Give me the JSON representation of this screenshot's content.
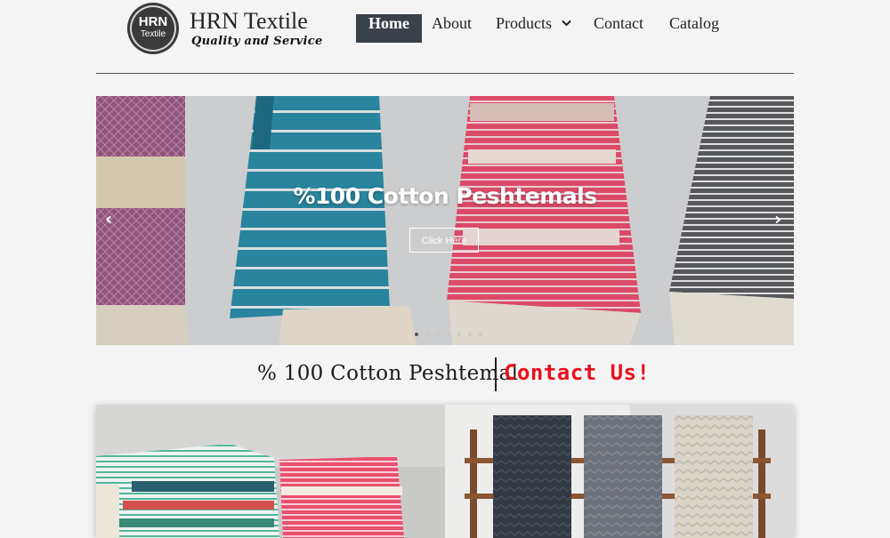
{
  "brand": {
    "logo_top": "HRN",
    "logo_bottom": "Textile",
    "title": "HRN Textile",
    "tagline": "Quality and Service"
  },
  "nav": {
    "items": [
      {
        "label": "Home",
        "active": true
      },
      {
        "label": "About",
        "active": false
      },
      {
        "label": "Products",
        "active": false,
        "dropdown": true
      },
      {
        "label": "Contact",
        "active": false
      },
      {
        "label": "Catalog",
        "active": false
      }
    ]
  },
  "hero": {
    "title": "%100 Cotton Peshtemals",
    "button_label": "Click Here",
    "prev_icon": "chevron-left-icon",
    "next_icon": "chevron-right-icon",
    "slide_count": 7,
    "active_slide": 1
  },
  "tagline": {
    "left": "% 100 Cotton Peshtemal",
    "right": "Contact Us!"
  },
  "colors": {
    "background": "#f4f4f4",
    "nav_active_bg": "#3b4148",
    "contact_red": "#e8101c",
    "text": "#222222"
  }
}
